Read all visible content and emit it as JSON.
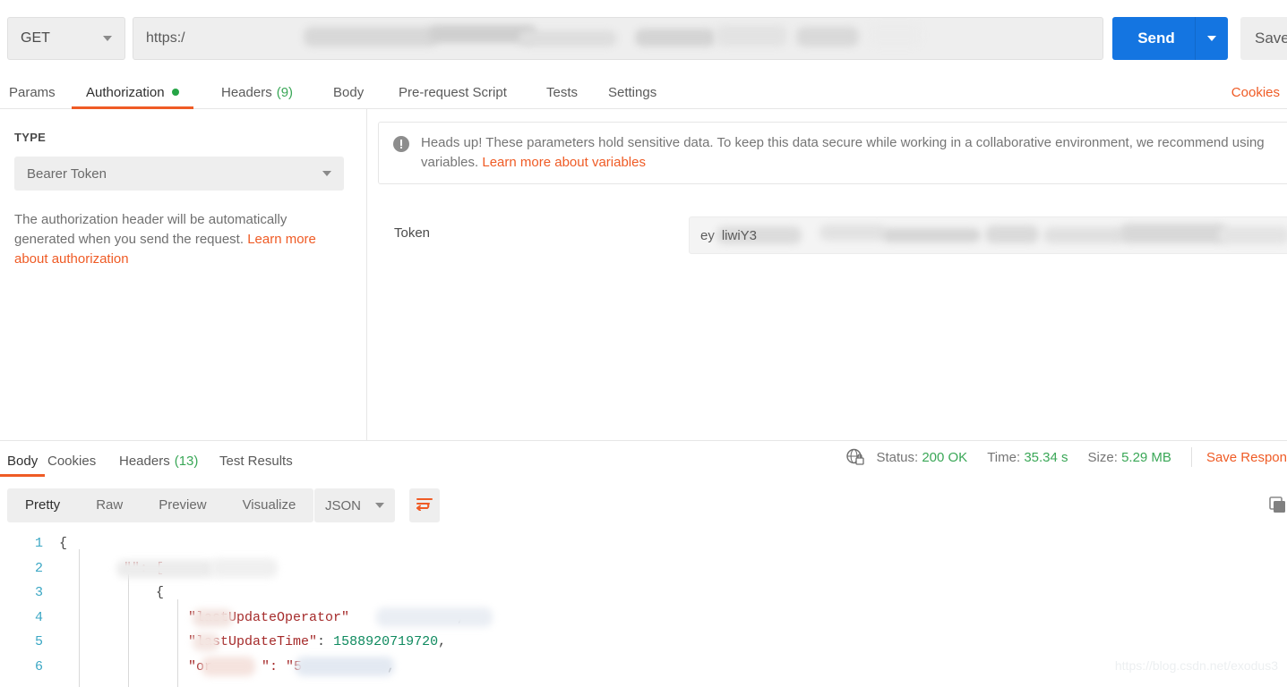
{
  "request": {
    "method": "GET",
    "url_prefix": "https:/",
    "url_redacted": true,
    "send_label": "Send",
    "save_label": "Save",
    "tabs": [
      {
        "label": "Params",
        "active": false,
        "badge": "",
        "dot": false
      },
      {
        "label": "Authorization",
        "active": true,
        "badge": "",
        "dot": true
      },
      {
        "label": "Headers",
        "active": false,
        "badge": "(9)",
        "dot": false
      },
      {
        "label": "Body",
        "active": false,
        "badge": "",
        "dot": false
      },
      {
        "label": "Pre-request Script",
        "active": false,
        "badge": "",
        "dot": false
      },
      {
        "label": "Tests",
        "active": false,
        "badge": "",
        "dot": false
      },
      {
        "label": "Settings",
        "active": false,
        "badge": "",
        "dot": false
      }
    ],
    "cookies_link": "Cookies"
  },
  "authorization": {
    "type_label": "TYPE",
    "type_value": "Bearer Token",
    "description_text": "The authorization header will be automatically generated when you send the request. ",
    "description_link": "Learn more about authorization",
    "heads_up_text": "Heads up! These parameters hold sensitive data. To keep this data secure while working in a collaborative environment, we recommend using variables. ",
    "heads_up_link": "Learn more about variables",
    "token_label": "Token",
    "token_value": "ey",
    "token_suffix": "liwiY3"
  },
  "response": {
    "tabs": [
      {
        "label": "Body",
        "active": true,
        "badge": ""
      },
      {
        "label": "Cookies",
        "active": false,
        "badge": ""
      },
      {
        "label": "Headers",
        "active": false,
        "badge": "(13)"
      },
      {
        "label": "Test Results",
        "active": false,
        "badge": ""
      }
    ],
    "status_label": "Status:",
    "status_value": "200 OK",
    "time_label": "Time:",
    "time_value": "35.34 s",
    "size_label": "Size:",
    "size_value": "5.29 MB",
    "save_response": "Save Respon",
    "view_modes": [
      {
        "label": "Pretty",
        "active": true
      },
      {
        "label": "Raw",
        "active": false
      },
      {
        "label": "Preview",
        "active": false
      },
      {
        "label": "Visualize",
        "active": false
      }
    ],
    "format": "JSON",
    "body_lines": [
      {
        "num": "1",
        "segments": [
          {
            "t": "{",
            "c": "p"
          }
        ]
      },
      {
        "num": "2",
        "segments": [
          {
            "t": "        \"",
            "c": "k"
          },
          {
            "t": "\": [",
            "c": "k"
          }
        ]
      },
      {
        "num": "3",
        "segments": [
          {
            "t": "            {",
            "c": "p"
          }
        ]
      },
      {
        "num": "4",
        "segments": [
          {
            "t": "                \"lastUpdateOperator\"",
            "c": "k"
          },
          {
            "t": ",",
            "c": "p"
          }
        ]
      },
      {
        "num": "5",
        "segments": [
          {
            "t": "                \"lastUpdateTime\"",
            "c": "k"
          },
          {
            "t": ": ",
            "c": "p"
          },
          {
            "t": "1588920719720",
            "c": "n"
          },
          {
            "t": ",",
            "c": "p"
          }
        ]
      },
      {
        "num": "6",
        "segments": [
          {
            "t": "                \"or",
            "c": "k"
          },
          {
            "t": "\": \"5",
            "c": "k"
          },
          {
            "t": ",",
            "c": "p"
          }
        ]
      }
    ]
  },
  "watermark": "https://blog.csdn.net/exodus3",
  "colors": {
    "accent_orange": "#ef5b25",
    "send_blue": "#1475e1",
    "status_green": "#3aa757",
    "panel_gray": "#eeeeee"
  }
}
